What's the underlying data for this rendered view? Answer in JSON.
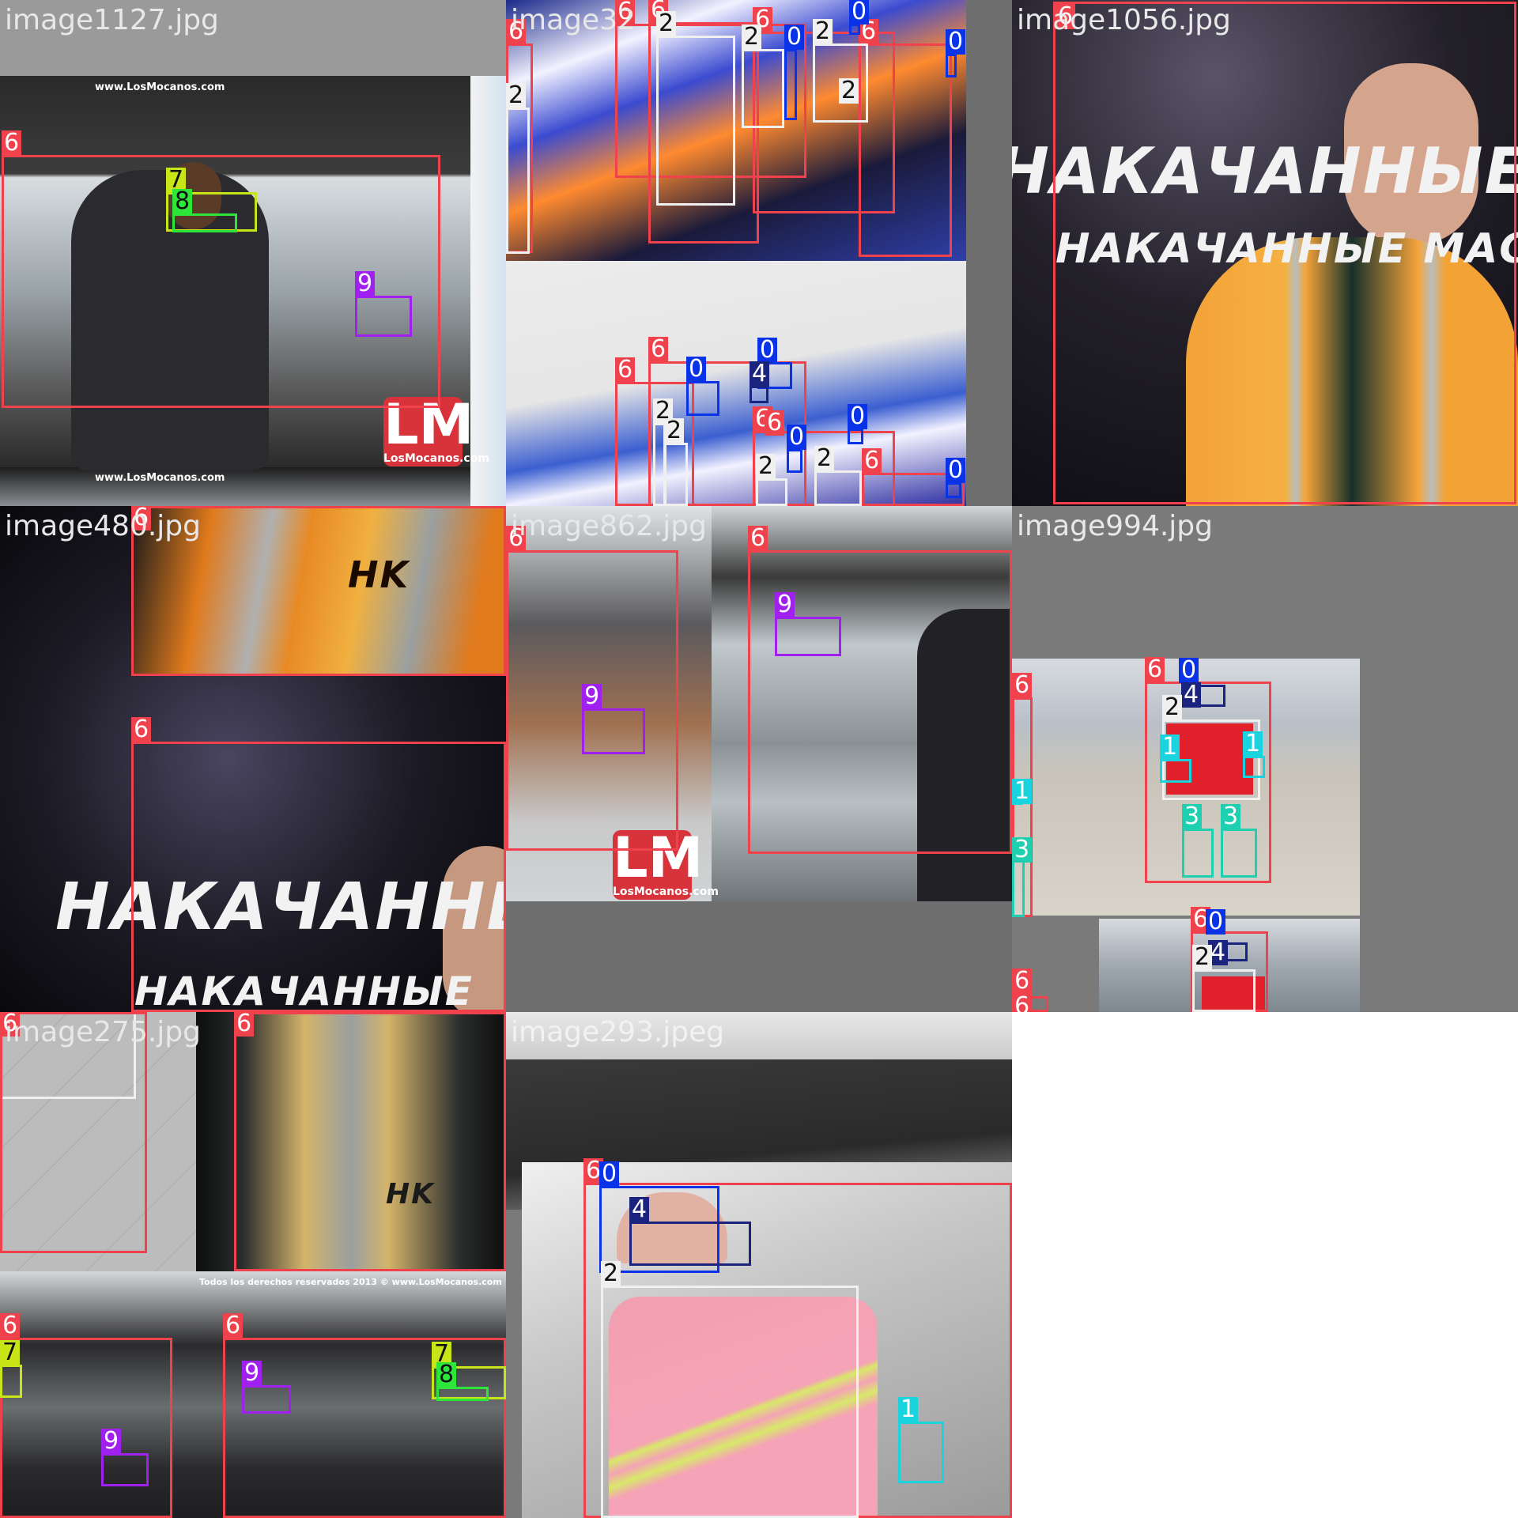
{
  "class_colors": {
    "0": "#0a32e6",
    "1": "#19d3df",
    "2": "#f0f0f0",
    "3": "#1ecfb0",
    "4": "#1a237e",
    "6": "#f0424c",
    "7": "#c8e617",
    "8": "#2ee63a",
    "9": "#a020f0"
  },
  "tiles": [
    {
      "title": "image1127.jpg",
      "watermark_top": "www.LosMocanos.com",
      "watermark_bottom": "www.LosMocanos.com",
      "logo_big": "LM",
      "logo_small": "LosMocanos.com",
      "labels": [
        {
          "cls": "6",
          "text": "6"
        },
        {
          "cls": "7",
          "text": "7"
        },
        {
          "cls": "8",
          "text": "8"
        },
        {
          "cls": "9",
          "text": "9"
        }
      ]
    },
    {
      "title": "image32",
      "labels": [
        {
          "cls": "6",
          "text": "6"
        },
        {
          "cls": "6",
          "text": "6"
        },
        {
          "cls": "6",
          "text": "6"
        },
        {
          "cls": "6",
          "text": "6"
        },
        {
          "cls": "6",
          "text": "6"
        },
        {
          "cls": "2",
          "text": "2"
        },
        {
          "cls": "2",
          "text": "2"
        },
        {
          "cls": "2",
          "text": "2"
        },
        {
          "cls": "2",
          "text": "2"
        },
        {
          "cls": "2",
          "text": "2"
        },
        {
          "cls": "0",
          "text": "0"
        },
        {
          "cls": "0",
          "text": "0"
        },
        {
          "cls": "0",
          "text": "0"
        },
        {
          "cls": "6",
          "text": "6"
        },
        {
          "cls": "6",
          "text": "6"
        },
        {
          "cls": "6",
          "text": "6"
        },
        {
          "cls": "6",
          "text": "6"
        },
        {
          "cls": "6",
          "text": "6"
        },
        {
          "cls": "0",
          "text": "0"
        },
        {
          "cls": "0",
          "text": "0"
        },
        {
          "cls": "0",
          "text": "0"
        },
        {
          "cls": "0",
          "text": "0"
        },
        {
          "cls": "0",
          "text": "0"
        },
        {
          "cls": "4",
          "text": "4"
        },
        {
          "cls": "2",
          "text": "2"
        },
        {
          "cls": "2",
          "text": "2"
        },
        {
          "cls": "2",
          "text": "2"
        },
        {
          "cls": "2",
          "text": "2"
        }
      ]
    },
    {
      "title": "image1056.jpg",
      "banner_1": "НАКАЧАННЫЕ",
      "banner_2": "НАКАЧАННЫЕ МАССА",
      "labels": [
        {
          "cls": "6",
          "text": "6"
        }
      ]
    },
    {
      "title": "image480.jpg",
      "banner_1": "НАКАЧАННЫЕ",
      "banner_2": "НАКАЧАННЫЕ",
      "vest_mark": "HK",
      "labels": [
        {
          "cls": "6",
          "text": "6"
        },
        {
          "cls": "6",
          "text": "6"
        }
      ]
    },
    {
      "title": "image862.jpg",
      "logo_big": "LM",
      "logo_small": "LosMocanos.com",
      "labels": [
        {
          "cls": "6",
          "text": "6"
        },
        {
          "cls": "6",
          "text": "6"
        },
        {
          "cls": "9",
          "text": "9"
        },
        {
          "cls": "9",
          "text": "9"
        }
      ]
    },
    {
      "title": "image994.jpg",
      "labels": [
        {
          "cls": "6",
          "text": "6"
        },
        {
          "cls": "0",
          "text": "0"
        },
        {
          "cls": "4",
          "text": "4"
        },
        {
          "cls": "2",
          "text": "2"
        },
        {
          "cls": "1",
          "text": "1"
        },
        {
          "cls": "1",
          "text": "1"
        },
        {
          "cls": "3",
          "text": "3"
        },
        {
          "cls": "3",
          "text": "3"
        },
        {
          "cls": "6",
          "text": "6"
        },
        {
          "cls": "1",
          "text": "1"
        },
        {
          "cls": "3",
          "text": "3"
        },
        {
          "cls": "6",
          "text": "6"
        },
        {
          "cls": "0",
          "text": "0"
        },
        {
          "cls": "4",
          "text": "4"
        },
        {
          "cls": "2",
          "text": "2"
        },
        {
          "cls": "6",
          "text": "6"
        },
        {
          "cls": "6",
          "text": "6"
        }
      ]
    },
    {
      "title": "image275.jpg",
      "vest_mark": "HK",
      "watermark": "Todos los derechos reservados 2013 © www.LosMocanos.com",
      "labels": [
        {
          "cls": "6",
          "text": "6"
        },
        {
          "cls": "6",
          "text": "6"
        },
        {
          "cls": "6",
          "text": "6"
        },
        {
          "cls": "6",
          "text": "6"
        },
        {
          "cls": "7",
          "text": "7"
        },
        {
          "cls": "9",
          "text": "9"
        },
        {
          "cls": "9",
          "text": "9"
        },
        {
          "cls": "7",
          "text": "7"
        },
        {
          "cls": "8",
          "text": "8"
        }
      ]
    },
    {
      "title": "image293.jpeg",
      "labels": [
        {
          "cls": "6",
          "text": "6"
        },
        {
          "cls": "0",
          "text": "0"
        },
        {
          "cls": "4",
          "text": "4"
        },
        {
          "cls": "2",
          "text": "2"
        },
        {
          "cls": "1",
          "text": "1"
        }
      ]
    }
  ]
}
